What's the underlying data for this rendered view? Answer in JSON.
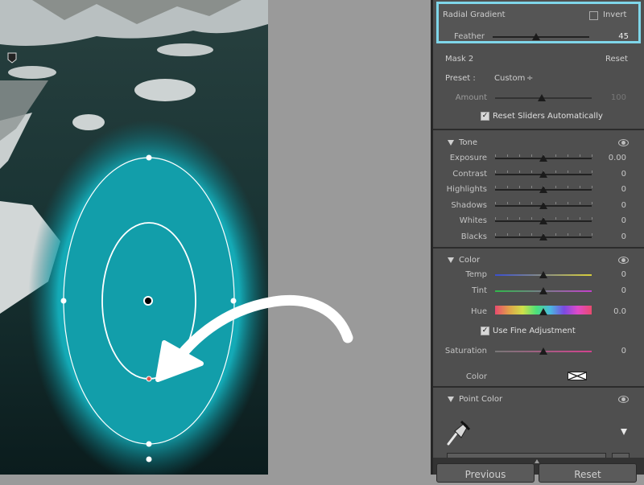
{
  "mask_header": {
    "title": "Radial Gradient",
    "invert_label": "Invert",
    "feather_label": "Feather",
    "feather_value": "45",
    "feather_level": 0.45
  },
  "mask_panel": {
    "mask_name": "Mask 2",
    "reset_label": "Reset",
    "preset_label": "Preset :",
    "preset_value": "Custom",
    "preset_caret": "÷",
    "amount_label": "Amount",
    "amount_value": "100",
    "reset_sliders_label": "Reset Sliders Automatically",
    "reset_sliders_checked": true
  },
  "tone": {
    "title": "Tone",
    "sliders": [
      {
        "label": "Exposure",
        "value": "0.00"
      },
      {
        "label": "Contrast",
        "value": "0"
      },
      {
        "label": "Highlights",
        "value": "0"
      },
      {
        "label": "Shadows",
        "value": "0"
      },
      {
        "label": "Whites",
        "value": "0"
      },
      {
        "label": "Blacks",
        "value": "0"
      }
    ]
  },
  "color_section": {
    "title": "Color",
    "temp_label": "Temp",
    "temp_value": "0",
    "tint_label": "Tint",
    "tint_value": "0",
    "hue_label": "Hue",
    "hue_value": "0.0",
    "fine_label": "Use Fine Adjustment",
    "fine_checked": true,
    "saturation_label": "Saturation",
    "saturation_value": "0",
    "color_label": "Color"
  },
  "point_color": {
    "title": "Point Color"
  },
  "footer": {
    "previous_label": "Previous",
    "reset_label": "Reset"
  },
  "colors": {
    "panel_bg": "#4f4f4f",
    "highlight_border": "#7fd6ea",
    "mask_overlay": "#1ab3bf",
    "arrow": "#ffffff"
  },
  "icons": [
    "eye-icon",
    "eyedropper-icon",
    "disclosure-triangle-icon",
    "pin-icon",
    "color-swatch-icon"
  ]
}
